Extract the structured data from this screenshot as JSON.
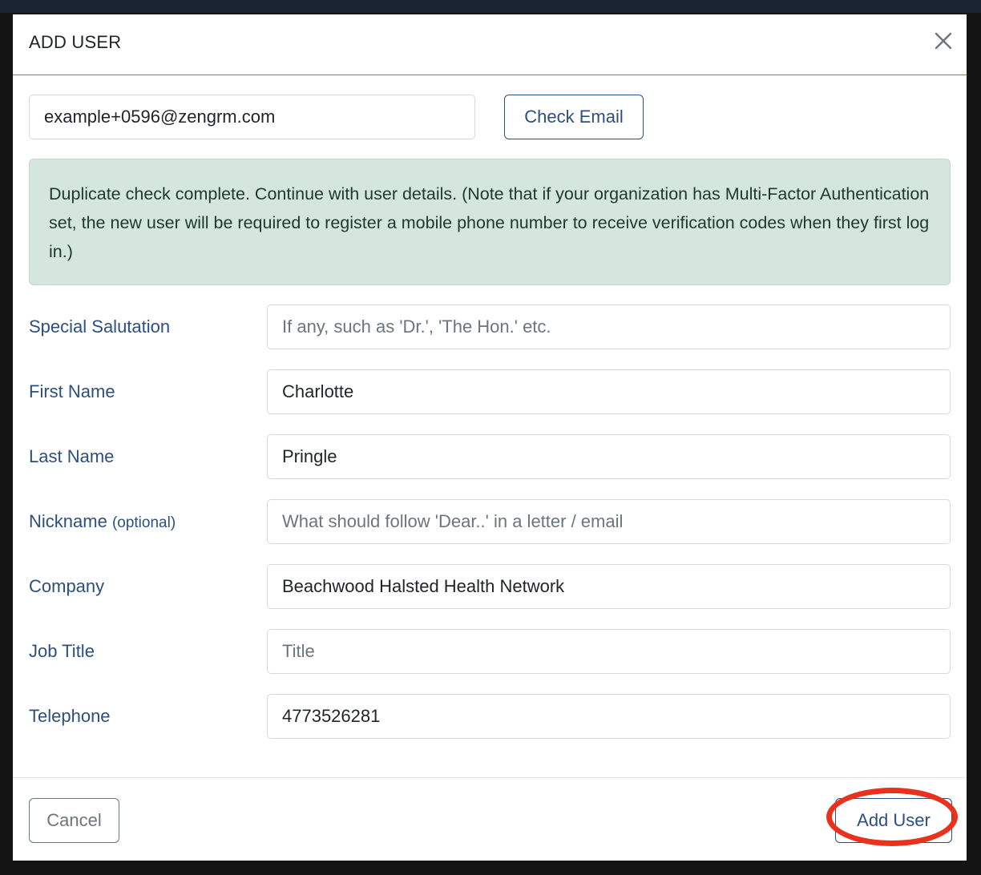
{
  "modal": {
    "title": "ADD USER",
    "close_icon": "close-icon"
  },
  "email_check": {
    "email_value": "example+0596@zengrm.com",
    "check_button_label": "Check Email"
  },
  "alert": {
    "message": "Duplicate check complete. Continue with user details. (Note that if your organization has Multi-Factor Authentication set, the new user will be required to register a mobile phone number to receive verification codes when they first log in.)",
    "background_color": "#d4e6dd"
  },
  "form": {
    "fields": [
      {
        "label": "Special Salutation",
        "value": "",
        "placeholder": "If any, such as 'Dr.', 'The Hon.' etc."
      },
      {
        "label": "First Name",
        "value": "Charlotte",
        "placeholder": ""
      },
      {
        "label": "Last Name",
        "value": "Pringle",
        "placeholder": ""
      },
      {
        "label": "Nickname",
        "label_suffix": "(optional)",
        "value": "",
        "placeholder": "What should follow 'Dear..' in a letter / email"
      },
      {
        "label": "Company",
        "value": "Beachwood Halsted Health Network",
        "placeholder": ""
      },
      {
        "label": "Job Title",
        "value": "",
        "placeholder": "Title"
      },
      {
        "label": "Telephone",
        "value": "4773526281",
        "placeholder": ""
      }
    ]
  },
  "footer": {
    "cancel_label": "Cancel",
    "add_user_label": "Add User"
  },
  "colors": {
    "label": "#2c4f7c",
    "highlight": "#e8321e",
    "header_divider": "#d9534f"
  }
}
